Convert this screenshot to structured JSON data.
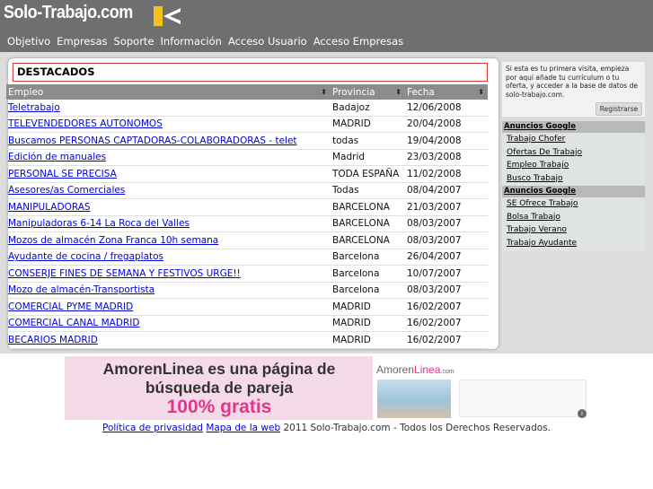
{
  "header": {
    "logo_text": "Solo-Trabajo.com",
    "nav": [
      "Objetivo",
      "Empresas",
      "Soporte",
      "Información",
      "Acceso Usuario",
      "Acceso Empresas"
    ]
  },
  "main": {
    "section_title": "DESTACADOS",
    "columns": [
      "Empleo",
      "Provincia",
      "Fecha"
    ],
    "rows": [
      {
        "empleo": "Teletrabajo",
        "provincia": "Badajoz",
        "fecha": "12/06/2008"
      },
      {
        "empleo": "TELEVENDEDORES AUTONOMOS",
        "provincia": "MADRID",
        "fecha": "20/04/2008"
      },
      {
        "empleo": "Buscamos PERSONAS CAPTADORAS-COLABORADORAS - telet",
        "provincia": "todas",
        "fecha": "19/04/2008"
      },
      {
        "empleo": "Edición de manuales",
        "provincia": "Madrid",
        "fecha": "23/03/2008"
      },
      {
        "empleo": "PERSONAL SE PRECISA",
        "provincia": "TODA ESPAÑA",
        "fecha": "11/02/2008"
      },
      {
        "empleo": "Asesores/as Comerciales",
        "provincia": "Todas",
        "fecha": "08/04/2007"
      },
      {
        "empleo": "MANIPULADORAS",
        "provincia": "BARCELONA",
        "fecha": "21/03/2007"
      },
      {
        "empleo": "Manipuladoras 6-14 La Roca del Valles",
        "provincia": "BARCELONA",
        "fecha": "08/03/2007"
      },
      {
        "empleo": "Mozos de almacén Zona Franca 10h semana",
        "provincia": "BARCELONA",
        "fecha": "08/03/2007"
      },
      {
        "empleo": "Ayudante de cocina / fregaplatos",
        "provincia": "Barcelona",
        "fecha": "26/04/2007"
      },
      {
        "empleo": "CONSERJE FINES DE SEMANA Y FESTIVOS URGE!!",
        "provincia": "Barcelona",
        "fecha": "10/07/2007"
      },
      {
        "empleo": "Mozo de almacén-Transportista",
        "provincia": "Barcelona",
        "fecha": "08/03/2007"
      },
      {
        "empleo": "COMERCIAL PYME MADRID",
        "provincia": "MADRID",
        "fecha": "16/02/2007"
      },
      {
        "empleo": "COMERCIAL CANAL MADRID",
        "provincia": "MADRID",
        "fecha": "16/02/2007"
      },
      {
        "empleo": "BECARIOS MADRID",
        "provincia": "MADRID",
        "fecha": "16/02/2007"
      }
    ]
  },
  "sidebar": {
    "welcome_text": "Si esta es tu primera visita, empieza por aqui añade tu currículum o tu oferta, y acceder a la base de datos de solo-trabajo.com.",
    "register_label": "Registrarse",
    "ads_header_1": "Anuncios Google",
    "ads_1": [
      "Trabajo Chofer",
      "Ofertas De Trabajo",
      "Empleo Trabajo",
      "Busco Trabajo"
    ],
    "ads_header_2": "Anuncios Google",
    "ads_2": [
      "SE Ofrece Trabajo",
      "Bolsa Trabajo",
      "Trabajo Verano",
      "Trabajo Ayudante"
    ]
  },
  "banner": {
    "headline": "AmorenLinea es una página de búsqueda de pareja",
    "highlight": "100% gratis",
    "brand_prefix": "Amoren",
    "brand_suffix": "Linea",
    "brand_tld": ".com"
  },
  "footer": {
    "privacy": "Política de privasidad",
    "sitemap": "Mapa de la web",
    "copyright": "2011 Solo-Trabajo.com - Todos los Derechos Reservados."
  },
  "colors": {
    "header_bg": "#6f6f6f",
    "content_bg": "#dcdcdc",
    "table_header_bg": "#8c8c8c",
    "link": "#0000dd",
    "accent_yellow": "#f7c21d",
    "banner_pink": "#e2358d"
  },
  "icons": {
    "logo_mark": "k-arrow-logo-icon",
    "sort": "sort-arrows-icon",
    "banner_info": "info-icon"
  }
}
